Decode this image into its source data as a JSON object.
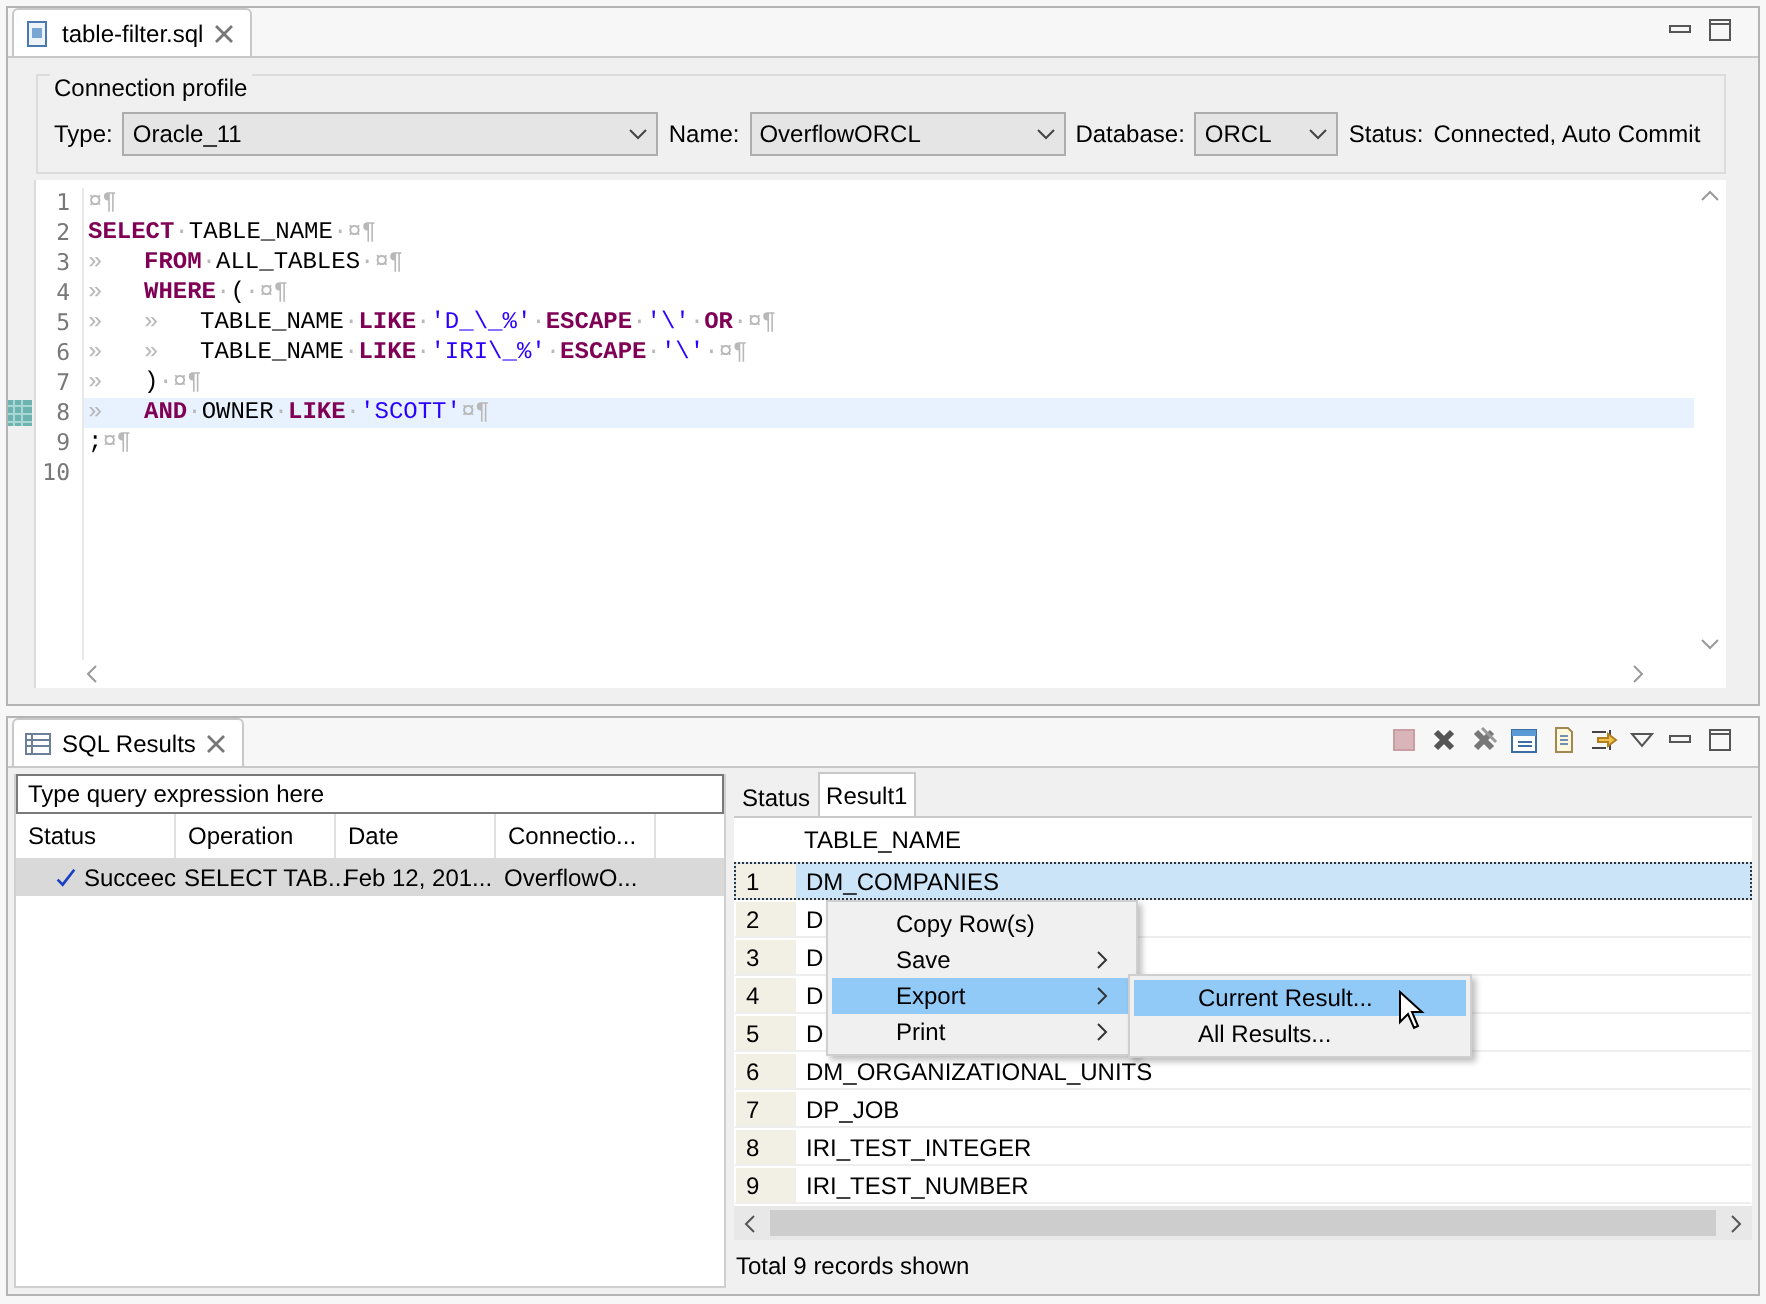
{
  "editor_tab": {
    "title": "table-filter.sql"
  },
  "connection_profile": {
    "legend": "Connection profile",
    "fields": [
      {
        "label": "Type:",
        "value": "Oracle_11",
        "kind": "wide"
      },
      {
        "label": "Name:",
        "value": "OverflowORCL",
        "kind": "medium"
      },
      {
        "label": "Database:",
        "value": "ORCL",
        "kind": "narrow"
      }
    ],
    "status_label": "Status:",
    "status_value": "Connected, Auto Commit"
  },
  "editor": {
    "lines": [
      {
        "number": "1",
        "current": false,
        "tokens": [
          {
            "kind": "ws",
            "text": "¤¶"
          }
        ]
      },
      {
        "number": "2",
        "current": false,
        "tokens": [
          {
            "kind": "kw",
            "text": "SELECT"
          },
          {
            "kind": "ws",
            "text": "·"
          },
          {
            "kind": "plain",
            "text": "TABLE_NAME"
          },
          {
            "kind": "ws",
            "text": "·¤¶"
          }
        ]
      },
      {
        "number": "3",
        "current": false,
        "tokens": [
          {
            "kind": "tab",
            "text": "»"
          },
          {
            "kind": "kw",
            "text": "FROM"
          },
          {
            "kind": "ws",
            "text": "·"
          },
          {
            "kind": "plain",
            "text": "ALL_TABLES"
          },
          {
            "kind": "ws",
            "text": "·¤¶"
          }
        ]
      },
      {
        "number": "4",
        "current": false,
        "tokens": [
          {
            "kind": "tab",
            "text": "»"
          },
          {
            "kind": "kw",
            "text": "WHERE"
          },
          {
            "kind": "ws",
            "text": "·"
          },
          {
            "kind": "plain",
            "text": "("
          },
          {
            "kind": "ws",
            "text": "·¤¶"
          }
        ]
      },
      {
        "number": "5",
        "current": false,
        "tokens": [
          {
            "kind": "tab",
            "text": "»"
          },
          {
            "kind": "tab",
            "text": "»"
          },
          {
            "kind": "plain",
            "text": "TABLE_NAME"
          },
          {
            "kind": "ws",
            "text": "·"
          },
          {
            "kind": "kw",
            "text": "LIKE"
          },
          {
            "kind": "ws",
            "text": "·"
          },
          {
            "kind": "str",
            "text": "'D_\\_%'"
          },
          {
            "kind": "ws",
            "text": "·"
          },
          {
            "kind": "kw",
            "text": "ESCAPE"
          },
          {
            "kind": "ws",
            "text": "·"
          },
          {
            "kind": "str",
            "text": "'\\'"
          },
          {
            "kind": "ws",
            "text": "·"
          },
          {
            "kind": "kw",
            "text": "OR"
          },
          {
            "kind": "ws",
            "text": "·¤¶"
          }
        ]
      },
      {
        "number": "6",
        "current": false,
        "tokens": [
          {
            "kind": "tab",
            "text": "»"
          },
          {
            "kind": "tab",
            "text": "»"
          },
          {
            "kind": "plain",
            "text": "TABLE_NAME"
          },
          {
            "kind": "ws",
            "text": "·"
          },
          {
            "kind": "kw",
            "text": "LIKE"
          },
          {
            "kind": "ws",
            "text": "·"
          },
          {
            "kind": "str",
            "text": "'IRI\\_%'"
          },
          {
            "kind": "ws",
            "text": "·"
          },
          {
            "kind": "kw",
            "text": "ESCAPE"
          },
          {
            "kind": "ws",
            "text": "·"
          },
          {
            "kind": "str",
            "text": "'\\'"
          },
          {
            "kind": "ws",
            "text": "·¤¶"
          }
        ]
      },
      {
        "number": "7",
        "current": false,
        "tokens": [
          {
            "kind": "tab",
            "text": "»"
          },
          {
            "kind": "plain",
            "text": ")"
          },
          {
            "kind": "ws",
            "text": "·¤¶"
          }
        ]
      },
      {
        "number": "8",
        "current": true,
        "tokens": [
          {
            "kind": "tab",
            "text": "»"
          },
          {
            "kind": "kw",
            "text": "AND"
          },
          {
            "kind": "ws",
            "text": "·"
          },
          {
            "kind": "plain",
            "text": "OWNER"
          },
          {
            "kind": "ws",
            "text": "·"
          },
          {
            "kind": "kw",
            "text": "LIKE"
          },
          {
            "kind": "ws",
            "text": "·"
          },
          {
            "kind": "str",
            "text": "'SCOTT'"
          },
          {
            "kind": "ws",
            "text": "¤¶"
          }
        ]
      },
      {
        "number": "9",
        "current": false,
        "tokens": [
          {
            "kind": "plain",
            "text": ";"
          },
          {
            "kind": "ws",
            "text": "¤¶"
          }
        ]
      },
      {
        "number": "10",
        "current": false
      }
    ]
  },
  "results_tab": {
    "title": "SQL Results"
  },
  "history": {
    "placeholder": "Type query expression here",
    "columns": [
      "Status",
      "Operation",
      "Date",
      "Connectio..."
    ],
    "rows": [
      {
        "status": "Succeec",
        "operation": "SELECT TAB...",
        "date": "Feb 12, 201...",
        "connection": "OverflowO...",
        "selected": true
      }
    ]
  },
  "result_tabs": [
    {
      "label": "Status",
      "selected": false
    },
    {
      "label": "Result1",
      "selected": true
    }
  ],
  "result_table": {
    "columns": [
      "TABLE_NAME"
    ],
    "rows": [
      {
        "number": "1",
        "name": "DM_COMPANIES",
        "selected": true
      },
      {
        "number": "2",
        "name": "D",
        "selected": false
      },
      {
        "number": "3",
        "name": "D",
        "selected": false
      },
      {
        "number": "4",
        "name": "D",
        "selected": false
      },
      {
        "number": "5",
        "name": "D",
        "selected": false
      },
      {
        "number": "6",
        "name": "DM_ORGANIZATIONAL_UNITS",
        "selected": false
      },
      {
        "number": "7",
        "name": "DP_JOB",
        "selected": false
      },
      {
        "number": "8",
        "name": "IRI_TEST_INTEGER",
        "selected": false
      },
      {
        "number": "9",
        "name": "IRI_TEST_NUMBER",
        "selected": false
      }
    ]
  },
  "context_menu": {
    "items": [
      {
        "label": "Copy Row(s)",
        "submenu": false,
        "selected": false
      },
      {
        "label": "Save",
        "submenu": true,
        "selected": false
      },
      {
        "label": "Export",
        "submenu": true,
        "selected": true
      },
      {
        "label": "Print",
        "submenu": true,
        "selected": false
      }
    ]
  },
  "submenu": {
    "items": [
      {
        "label": "Current Result...",
        "selected": true
      },
      {
        "label": "All Results...",
        "selected": false
      }
    ]
  },
  "footer": "Total 9 records shown"
}
